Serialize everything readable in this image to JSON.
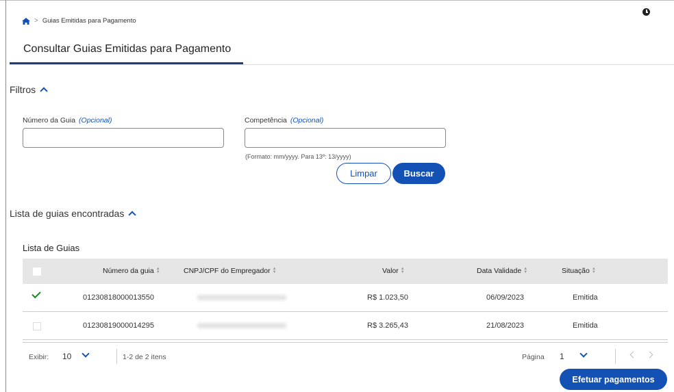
{
  "breadcrumb": {
    "current": "Guias Emitidas para Pagamento",
    "separator": ">"
  },
  "tabs": [
    {
      "label": "Consultar Guias Emitidas para Pagamento"
    }
  ],
  "filters": {
    "title": "Filtros",
    "numero_label": "Número da Guia",
    "numero_optional": "(Opcional)",
    "numero_value": "",
    "competencia_label": "Competência",
    "competencia_optional": "(Opcional)",
    "competencia_value": "",
    "competencia_hint": "(Formato: mm/yyyy. Para 13º: 13/yyyy)",
    "clear_label": "Limpar",
    "search_label": "Buscar"
  },
  "results": {
    "title": "Lista de guias encontradas"
  },
  "table": {
    "title": "Lista de Guias",
    "headers": [
      "Número da guia",
      "CNPJ/CPF do Empregador",
      "Valor",
      "Data Validade",
      "Situação"
    ],
    "rows": [
      {
        "selected": true,
        "numero": "01230818000013550",
        "valor": "R$ 1.023,50",
        "data": "06/09/2023",
        "situacao": "Emitida"
      },
      {
        "selected": false,
        "numero": "01230819000014295",
        "valor": "R$ 3.265,43",
        "data": "21/08/2023",
        "situacao": "Emitida"
      }
    ]
  },
  "pagination": {
    "show_label": "Exibir:",
    "page_size": "10",
    "range": "1-2 de 2 itens",
    "page_label": "Página",
    "page": "1"
  },
  "actions": {
    "pay_label": "Efetuar pagamentos"
  },
  "colors": {
    "primary": "#1351b4",
    "tab_underline": "#1a3f7a",
    "check": "#168821",
    "header_bg": "#e6e6e6"
  },
  "icons": [
    "home-icon",
    "clock-icon",
    "chevron-up-icon",
    "chevron-down-icon",
    "check-icon",
    "chevron-left-icon",
    "chevron-right-icon"
  ]
}
